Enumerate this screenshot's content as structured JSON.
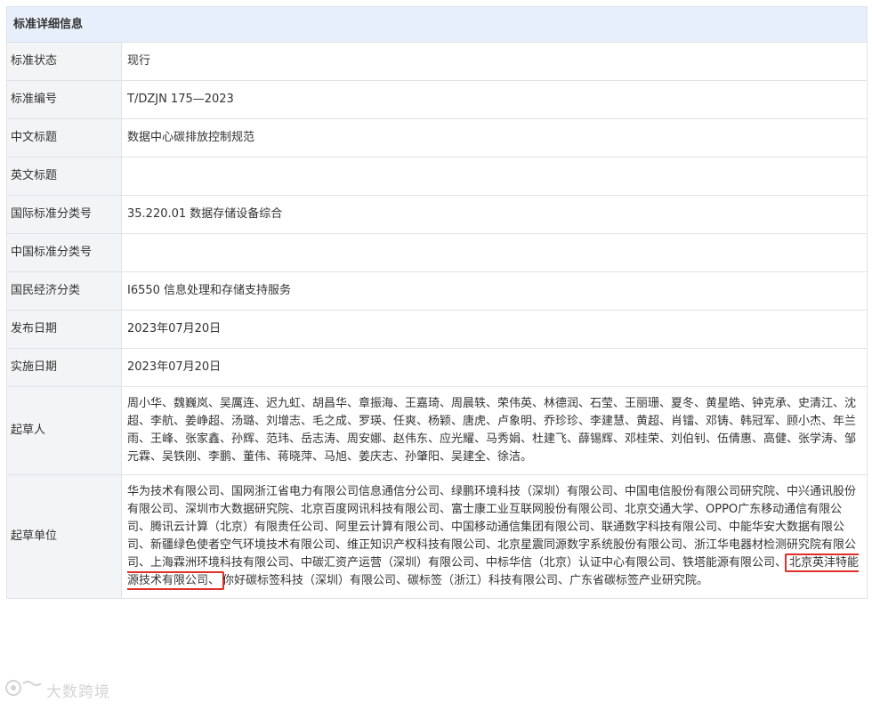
{
  "header": {
    "title": "标准详细信息"
  },
  "rows": [
    {
      "label": "标准状态",
      "value": "现行"
    },
    {
      "label": "标准编号",
      "value": "T/DZJN 175—2023"
    },
    {
      "label": "中文标题",
      "value": "数据中心碳排放控制规范"
    },
    {
      "label": "英文标题",
      "value": ""
    },
    {
      "label": "国际标准分类号",
      "value": "35.220.01 数据存储设备综合"
    },
    {
      "label": "中国标准分类号",
      "value": ""
    },
    {
      "label": "国民经济分类",
      "value": "I6550 信息处理和存储支持服务"
    },
    {
      "label": "发布日期",
      "value": "2023年07月20日"
    },
    {
      "label": "实施日期",
      "value": "2023年07月20日"
    }
  ],
  "drafters": {
    "label": "起草人",
    "value": "周小华、魏巍岚、吴厲连、迟九虹、胡昌华、章振海、王嘉琦、周晨轶、荣伟英、林德润、石莹、王丽珊、夏冬、黄星皓、钟克承、史清江、沈超、李航、姜峥超、汤璐、刘增志、毛之成、罗瑛、任爽、杨颖、唐虎、卢象明、乔珍珍、李建慧、黄超、肖镭、邓铸、韩冠军、顾小杰、年兰雨、王峰、张家鑫、孙辉、范玮、岳志涛、周安娜、赵伟东、应光耀、马秀娟、杜建飞、薛锡辉、邓桂荣、刘伯钊、伍倩惠、高健、张学涛、邹元霖、吴铁刚、李鹏、董伟、蒋晓萍、马旭、姜庆志、孙肇阳、吴建全、徐洁。"
  },
  "units": {
    "label": "起草单位",
    "value_before": "华为技术有限公司、国网浙江省电力有限公司信息通信分公司、绿鹏环境科技（深圳）有限公司、中国电信股份有限公司研究院、中兴通讯股份有限公司、深圳市大数据研究院、北京百度网讯科技有限公司、富士康工业互联网股份有限公司、北京交通大学、OPPO广东移动通信有限公司、腾讯云计算（北京）有限责任公司、阿里云计算有限公司、中国移动通信集团有限公司、联通数字科技有限公司、中能华安大数据有限公司、新疆绿色使者空气环境技术有限公司、维正知识产权科技有限公司、北京星震同源数字系统股份有限公司、浙江华电器材检测研究院有限公司、上海霖洲环境科技有限公司、中碳汇资产运营（深圳）有限公司、中标华信（北京）认证中心有限公司、铁塔能源有限公司、",
    "value_highlight": "北京英沣特能源技术有限公司、",
    "value_after": "你好碳标签科技（深圳）有限公司、碳标签（浙江）科技有限公司、广东省碳标签产业研究院。",
    "highlight_color": "#e0302a"
  },
  "watermark": {
    "icon": "camera-icon",
    "text": "大数跨境"
  }
}
